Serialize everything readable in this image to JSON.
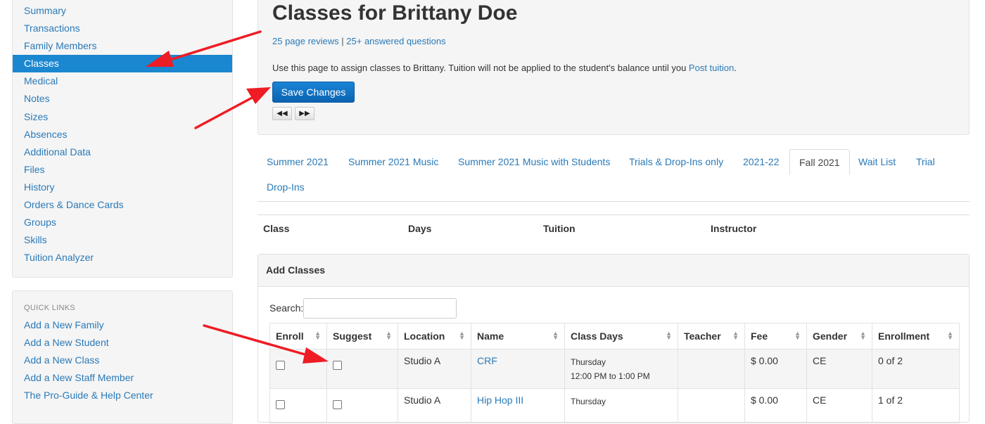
{
  "sidebar": {
    "nav_items": [
      {
        "label": "Summary",
        "active": false
      },
      {
        "label": "Transactions",
        "active": false
      },
      {
        "label": "Family Members",
        "active": false
      },
      {
        "label": "Classes",
        "active": true
      },
      {
        "label": "Medical",
        "active": false
      },
      {
        "label": "Notes",
        "active": false
      },
      {
        "label": "Sizes",
        "active": false
      },
      {
        "label": "Absences",
        "active": false
      },
      {
        "label": "Additional Data",
        "active": false
      },
      {
        "label": "Files",
        "active": false
      },
      {
        "label": "History",
        "active": false
      },
      {
        "label": "Orders & Dance Cards",
        "active": false
      },
      {
        "label": "Groups",
        "active": false
      },
      {
        "label": "Skills",
        "active": false
      },
      {
        "label": "Tuition Analyzer",
        "active": false
      }
    ],
    "quick_links": {
      "title": "QUICK LINKS",
      "items": [
        "Add a New Family",
        "Add a New Student",
        "Add a New Class",
        "Add a New Staff Member",
        "The Pro-Guide & Help Center"
      ]
    }
  },
  "header": {
    "title": "Classes for Brittany Doe",
    "reviews_link": "25 page reviews",
    "separator": " | ",
    "questions_link": "25+ answered questions",
    "intro_text": "Use this page to assign classes to Brittany. Tuition will not be applied to the student's balance until you ",
    "post_tuition_link": "Post tuition",
    "intro_end": ".",
    "save_label": "Save Changes",
    "prev_icon": "◀◀",
    "next_icon": "▶▶"
  },
  "tabs": [
    {
      "label": "Summer 2021",
      "active": false
    },
    {
      "label": "Summer 2021 Music",
      "active": false
    },
    {
      "label": "Summer 2021 Music with Students",
      "active": false
    },
    {
      "label": "Trials & Drop-Ins only",
      "active": false
    },
    {
      "label": "2021-22",
      "active": false
    },
    {
      "label": "Fall 2021",
      "active": true
    },
    {
      "label": "Wait List",
      "active": false
    },
    {
      "label": "Trial",
      "active": false
    },
    {
      "label": "Drop-Ins",
      "active": false
    }
  ],
  "enrolled_table": {
    "columns": [
      "Class",
      "Days",
      "Tuition",
      "Instructor"
    ]
  },
  "add_classes": {
    "heading": "Add Classes",
    "search_label": "Search:",
    "search_value": "",
    "columns": [
      "Enroll",
      "Suggest",
      "Location",
      "Name",
      "Class Days",
      "Teacher",
      "Fee",
      "Gender",
      "Enrollment"
    ],
    "rows": [
      {
        "location": "Studio A",
        "name": "CRF",
        "day": "Thursday",
        "time": "12:00 PM to 1:00 PM",
        "teacher": "",
        "fee": "$ 0.00",
        "gender": "CE",
        "enrollment": "0 of 2"
      },
      {
        "location": "Studio A",
        "name": "Hip Hop III",
        "day": "Thursday",
        "time": "",
        "teacher": "",
        "fee": "$ 0.00",
        "gender": "CE",
        "enrollment": "1 of 2"
      }
    ]
  },
  "colors": {
    "link": "#2a7ab8",
    "active_nav": "#1a87d0",
    "annotation_arrow": "#ee1c24",
    "save_button": "#0b63b0"
  }
}
